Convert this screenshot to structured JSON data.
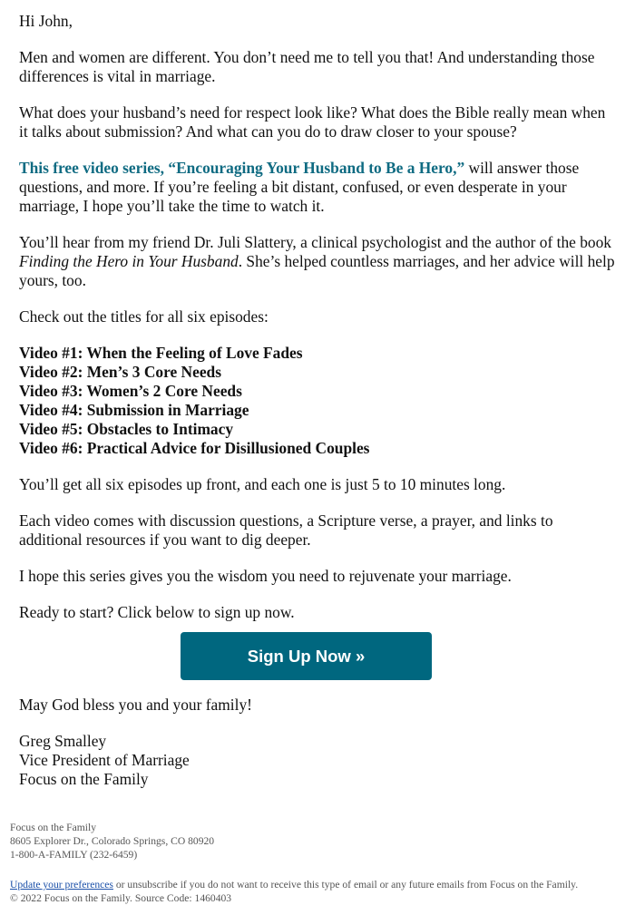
{
  "email": {
    "greeting": "Hi John,",
    "paragraphs": {
      "p1": "Men and women are different. You don’t need me to tell you that! And understanding those differences is vital in marriage.",
      "p2": "What does your husband’s need for respect look like? What does the Bible really mean when it talks about submission? And what can you do to draw closer to your spouse?",
      "p3_highlight": "This free video series, “Encouraging Your Husband to Be a Hero,”",
      "p3_rest": " will answer those questions, and more. If you’re feeling a bit distant, confused, or even desperate in your marriage, I hope you’ll take the time to watch it.",
      "p4_start": "You’ll hear from my friend Dr. Juli Slattery, a clinical psychologist and the author of the book ",
      "p4_book": "Finding the Hero in Your Husband",
      "p4_end": ". She’s helped countless marriages, and her advice will help yours, too.",
      "p5": "Check out the titles for all six episodes:",
      "p6": "You’ll get all six episodes up front, and each one is just 5 to 10 minutes long.",
      "p7": "Each video comes with discussion questions, a Scripture verse, a prayer, and links to additional resources if you want to dig deeper.",
      "p8": "I hope this series gives you the wisdom you need to rejuvenate your marriage.",
      "p9": "Ready to start? Click below to sign up now."
    },
    "videos": [
      "Video #1: When the Feeling of Love Fades",
      "Video #2: Men’s 3 Core Needs",
      "Video #3: Women’s 2 Core Needs",
      "Video #4: Submission in Marriage",
      "Video #5: Obstacles to Intimacy",
      "Video #6: Practical Advice for Disillusioned Couples"
    ],
    "cta": {
      "label": "Sign Up Now »",
      "color": "#00677f"
    },
    "blessing": "May God bless you and your family!",
    "signature": {
      "name": "Greg Smalley",
      "title": "Vice President of Marriage",
      "org": "Focus on the Family"
    }
  },
  "footer": {
    "org": "Focus on the Family",
    "address": "8605 Explorer Dr., Colorado Springs, CO 80920",
    "phone": "1-800-A-FAMILY (232-6459)",
    "preferences_link": "Update your preferences",
    "unsubscribe_text": " or unsubscribe if you do not want to receive this type of email or any future emails from Focus on the Family.",
    "copyright": "© 2022 Focus on the Family. Source Code:  1460403"
  },
  "colors": {
    "highlight": "#0f6b82",
    "link": "#1a4fa8",
    "button": "#00677f"
  }
}
